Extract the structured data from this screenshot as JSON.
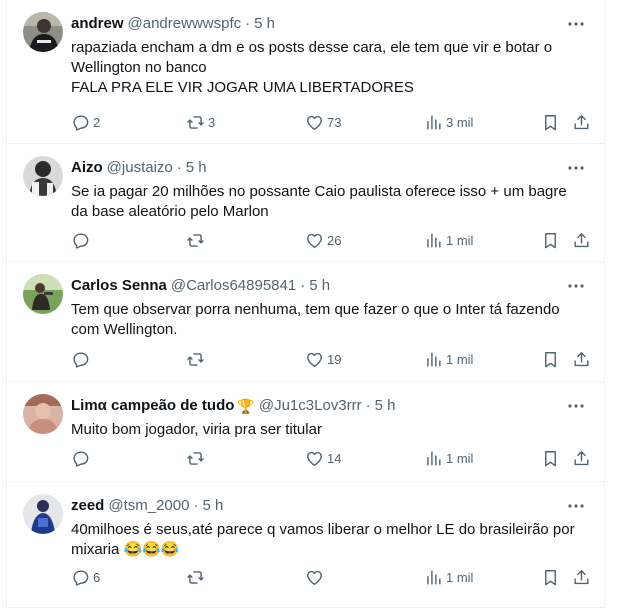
{
  "tweets": [
    {
      "name": "andrew",
      "handle": "@andrewwwspfc",
      "time": "5 h",
      "text": "rapaziada encham a dm e os posts desse cara, ele tem que vir e botar o\nWellington no banco\nFALA PRA ELE VIR JOGAR UMA LIBERTADORES",
      "replies": "2",
      "retweets": "3",
      "likes": "73",
      "views": "3 mil"
    },
    {
      "name": "Aizo",
      "handle": "@justaizo",
      "time": "5 h",
      "text": "Se ia pagar 20 milhões no possante Caio paulista oferece isso + um bagre\nda base aleatório pelo Marlon",
      "replies": "",
      "retweets": "",
      "likes": "26",
      "views": "1 mil"
    },
    {
      "name": "Carlos Senna",
      "handle": "@Carlos64895841",
      "time": "5 h",
      "text": "Tem que observar porra nenhuma, tem que fazer o que o Inter tá fazendo\ncom Wellington.",
      "replies": "",
      "retweets": "",
      "likes": "19",
      "views": "1 mil"
    },
    {
      "name": "Limα campeão de tudo",
      "name_emoji": "🏆",
      "handle": "@Ju1c3Lov3rrr",
      "time": "5 h",
      "text": "Muito bom jogador, viria pra ser titular",
      "replies": "",
      "retweets": "",
      "likes": "14",
      "views": "1 mil"
    },
    {
      "name": "zeed",
      "handle": "@tsm_2000",
      "time": "5 h",
      "text": "40milhoes é seus,até parece q vamos liberar o melhor LE do brasileirão por\nmixaria 😂😂😂",
      "replies": "6",
      "retweets": "",
      "likes": "",
      "views": "1 mil"
    }
  ],
  "separator": "·",
  "colors": {
    "text": "#0f1419",
    "secondary": "#536471",
    "border": "#eff3f4"
  },
  "icons": [
    "more-icon",
    "reply-icon",
    "retweet-icon",
    "like-icon",
    "views-icon",
    "bookmark-icon",
    "share-icon"
  ]
}
